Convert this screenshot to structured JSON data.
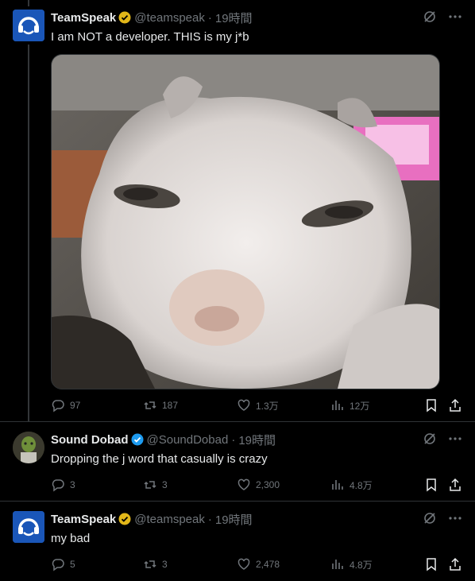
{
  "tweets": [
    {
      "name": "TeamSpeak",
      "handle": "@teamspeak",
      "dot": "·",
      "time": "19時間",
      "text": "I am NOT a developer. THIS is my j*b",
      "stats": {
        "replies": "97",
        "reposts": "187",
        "likes": "1.3万",
        "views": "12万"
      },
      "verified_color": "#e2b719"
    },
    {
      "name": "Sound Dobad",
      "handle": "@SoundDobad",
      "dot": "·",
      "time": "19時間",
      "text": "Dropping the j word that casually is crazy",
      "stats": {
        "replies": "3",
        "reposts": "3",
        "likes": "2,300",
        "views": "4.8万"
      },
      "verified_color": "#1d9bf0"
    },
    {
      "name": "TeamSpeak",
      "handle": "@teamspeak",
      "dot": "·",
      "time": "19時間",
      "text": "my bad",
      "stats": {
        "replies": "5",
        "reposts": "3",
        "likes": "2,478",
        "views": "4.8万"
      },
      "verified_color": "#e2b719"
    }
  ],
  "colors": {
    "background": "#000000",
    "text": "#e7e9ea",
    "muted": "#71767b",
    "line": "#333639"
  },
  "icons": [
    "grok-icon",
    "more-icon",
    "reply-icon",
    "repost-icon",
    "like-icon",
    "views-icon",
    "bookmark-icon",
    "share-icon"
  ]
}
